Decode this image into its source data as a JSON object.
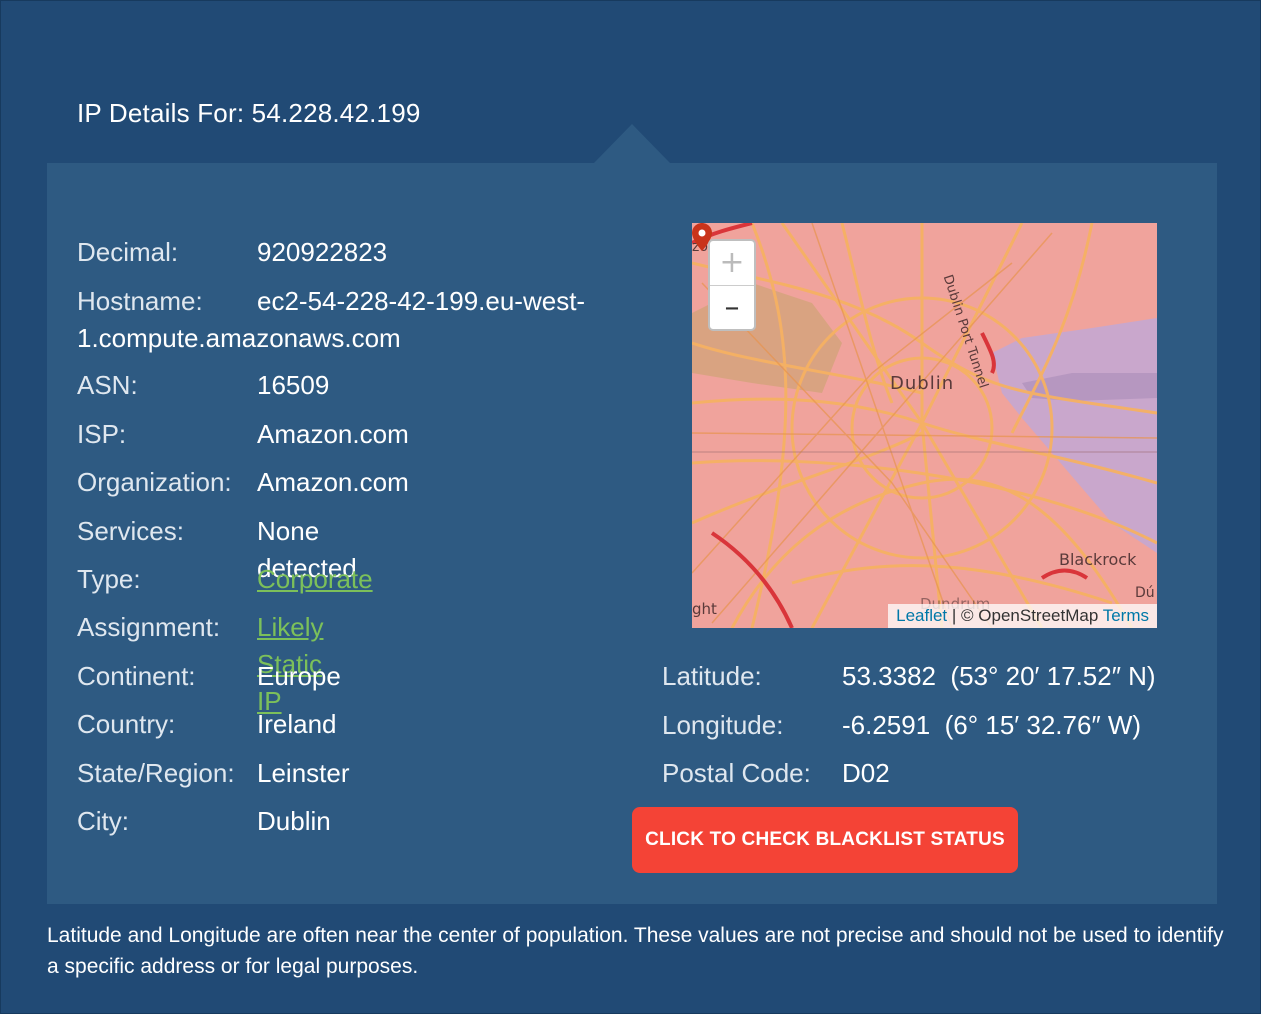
{
  "header": {
    "title": "IP Details For: 54.228.42.199"
  },
  "details": [
    {
      "label": "Decimal:",
      "value": "920922823"
    },
    {
      "label": "Hostname:",
      "value": "ec2-54-228-42-199.eu-west-1.compute.amazonaws.com"
    },
    {
      "label": "ASN:",
      "value": "16509"
    },
    {
      "label": "ISP:",
      "value": "Amazon.com"
    },
    {
      "label": "Organization:",
      "value": "Amazon.com"
    },
    {
      "label": "Services:",
      "value": "None detected"
    },
    {
      "label": "Type:",
      "value": "Corporate"
    },
    {
      "label": "Assignment:",
      "value": "Likely Static IP"
    },
    {
      "label": "Continent:",
      "value": "Europe"
    },
    {
      "label": "Country:",
      "value": "Ireland"
    },
    {
      "label": "State/Region:",
      "value": "Leinster"
    },
    {
      "label": "City:",
      "value": "Dublin"
    }
  ],
  "geo": [
    {
      "label": "Latitude:",
      "value": "53.3382  (53° 20′ 17.52″ N)"
    },
    {
      "label": "Longitude:",
      "value": "-6.2591  (6° 15′ 32.76″ W)"
    },
    {
      "label": "Postal Code:",
      "value": "D02"
    }
  ],
  "map": {
    "zoom_in": "+",
    "zoom_out": "–",
    "attribution": {
      "leaflet": "Leaflet",
      "separator": " | © ",
      "osm": "OpenStreetMap",
      "terms": "Terms"
    },
    "labels": {
      "city": "Dublin",
      "blackrock": "Blackrock",
      "tunnel": "Dublin Port Tunnel",
      "dundrum": "Dundrum",
      "left_edge": "ght",
      "top_left": "zo",
      "right_edge": "Dú"
    },
    "colors": {
      "land": "#f0a39c",
      "roads": "#f6b163",
      "water": "#c9a7cc",
      "park": "#d9a381",
      "marker": "#c9341b"
    }
  },
  "blacklist_button": "CLICK TO CHECK BLACKLIST STATUS",
  "footnote": "Latitude and Longitude are often near the center of population. These values are not precise and should not be used to identify a specific address or for legal purposes.",
  "colors": {
    "background": "#214a75",
    "panel": "#2e5a82",
    "link": "#7cc05a",
    "button": "#f44336"
  }
}
